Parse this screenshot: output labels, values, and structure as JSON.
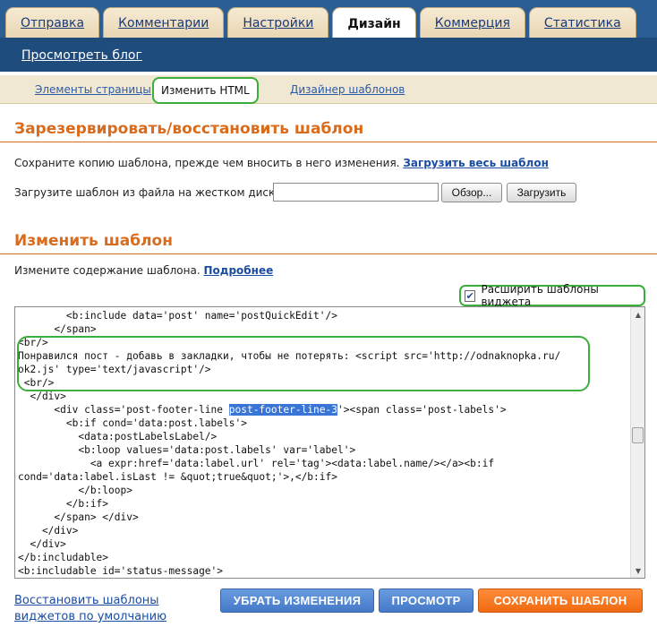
{
  "top_tabs": [
    {
      "label": "Отправка",
      "active": false
    },
    {
      "label": "Комментарии",
      "active": false
    },
    {
      "label": "Настройки",
      "active": false
    },
    {
      "label": "Дизайн",
      "active": true
    },
    {
      "label": "Коммерция",
      "active": false
    },
    {
      "label": "Статистика",
      "active": false
    }
  ],
  "view_blog": "Просмотреть блог",
  "sub_tabs": {
    "page_elements": "Элементы страницы",
    "edit_html": "Изменить HTML",
    "template_designer": "Дизайнер шаблонов"
  },
  "backup": {
    "title": "Зарезервировать/восстановить шаблон",
    "save_text": "Сохраните копию шаблона, прежде чем вносить в него изменения.",
    "download_link": "Загрузить весь шаблон",
    "upload_text": "Загрузите шаблон из файла на жестком диске:",
    "file_value": "",
    "browse_label": "Обзор...",
    "upload_label": "Загрузить"
  },
  "edit": {
    "title": "Изменить шаблон",
    "desc": "Измените содержание шаблона.",
    "more_link": "Подробнее",
    "expand_label": "Расширить шаблоны виджета",
    "expand_checked": true
  },
  "code_lines": [
    [
      "        <b:include data='post' name='postQuickEdit'/>"
    ],
    [
      "      </span>"
    ],
    [
      "<br/>"
    ],
    [
      "Понравился пост - добавь в закладки, чтобы не потерять: <script src='http://odnaknopka.ru/"
    ],
    [
      "ok2.js' type='text/javascript'/>"
    ],
    [
      " <br/>"
    ],
    [
      "  </div>"
    ],
    [
      "      <div class='post-footer-line ",
      "post-footer-line-3",
      "'><span class='post-labels'>"
    ],
    [
      "        <b:if cond='data:post.labels'>"
    ],
    [
      "          <data:postLabelsLabel/>"
    ],
    [
      "          <b:loop values='data:post.labels' var='label'>"
    ],
    [
      "            <a expr:href='data:label.url' rel='tag'><data:label.name/></a><b:if"
    ],
    [
      "cond='data:label.isLast != &quot;true&quot;'>,</b:if>"
    ],
    [
      "          </b:loop>"
    ],
    [
      "        </b:if>"
    ],
    [
      "      </span> </div>"
    ],
    [
      "    </div>"
    ],
    [
      "  </div>"
    ],
    [
      "</b:includable>"
    ],
    [
      "<b:includable id='status-message'>"
    ]
  ],
  "bottom": {
    "restore_link": "Восстановить шаблоны виджетов по умолчанию",
    "discard": "УБРАТЬ ИЗМЕНЕНИЯ",
    "preview": "ПРОСМОТР",
    "save": "СОХРАНИТЬ ШАБЛОН"
  },
  "icons": {
    "checkbox": "checkmark-icon",
    "scroll_up": "triangle-up-icon",
    "scroll_down": "triangle-down-icon"
  },
  "colors": {
    "header_blue": "#2a5e94",
    "accent_orange": "#d96b1c",
    "link_blue": "#1a4ca0",
    "highlight_green": "#3cae3c",
    "button_blue": "#4479c8",
    "button_orange": "#f06a10"
  }
}
